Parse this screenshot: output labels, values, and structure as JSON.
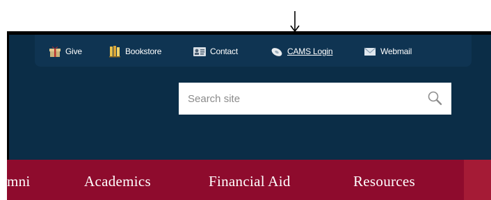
{
  "utility_links": [
    {
      "label": "Give",
      "icon": "gift-icon"
    },
    {
      "label": "Bookstore",
      "icon": "books-icon"
    },
    {
      "label": "Contact",
      "icon": "contact-card-icon"
    },
    {
      "label": "CAMS Login",
      "icon": "login-disc-icon"
    },
    {
      "label": "Webmail",
      "icon": "mail-icon"
    }
  ],
  "search": {
    "placeholder": "Search site"
  },
  "main_nav": [
    {
      "label": "mni"
    },
    {
      "label": "Academics"
    },
    {
      "label": "Financial Aid"
    },
    {
      "label": "Resources"
    }
  ],
  "colors": {
    "header_background": "#0b2d47",
    "utility_bar": "#0f3452",
    "nav_background": "#8e0b2d",
    "nav_accent": "#a51b36"
  }
}
